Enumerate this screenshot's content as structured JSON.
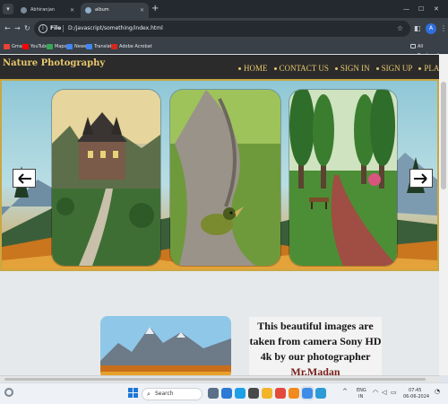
{
  "browser": {
    "tabs": [
      {
        "label": "Abhiranjan",
        "active": false
      },
      {
        "label": "album",
        "active": true
      }
    ],
    "new_tab_glyph": "+",
    "window_controls": [
      "—",
      "☐",
      "✕"
    ],
    "address": {
      "scheme_chip": "File",
      "url": "D:/javascript/something/index.html"
    },
    "avatar_letter": "A",
    "bookmarks": [
      {
        "label": "Gmail",
        "color": "#ea4335"
      },
      {
        "label": "YouTube",
        "color": "#ff0000"
      },
      {
        "label": "Maps",
        "color": "#34a853"
      },
      {
        "label": "News",
        "color": "#4285f4"
      },
      {
        "label": "Translate",
        "color": "#4285f4"
      },
      {
        "label": "Adobe Acrobat",
        "color": "#d7261e"
      }
    ],
    "all_bookmarks_label": "All Bookmarks"
  },
  "site": {
    "brand": "Nature Photography",
    "nav": [
      {
        "label": "HOME"
      },
      {
        "label": "CONTACT US"
      },
      {
        "label": "SIGN IN"
      },
      {
        "label": "SIGN UP"
      },
      {
        "label": "PLACE ORDER"
      }
    ],
    "carousel": {
      "prev_icon": "arrow-left-icon",
      "next_icon": "arrow-right-icon",
      "slides": [
        {
          "subject": "castle-mansion-photo"
        },
        {
          "subject": "bird-on-tree-photo"
        },
        {
          "subject": "park-path-bench-photo"
        }
      ]
    },
    "intro": {
      "text_before": "This beautiful images are taken from camera Sony HD 4k by our photographer",
      "photographer": "Mr.Madan"
    }
  },
  "taskbar": {
    "search_placeholder": "Search",
    "language": "ENG",
    "region": "IN",
    "time": "07:45",
    "date": "06-06-2024"
  },
  "colors": {
    "accent_gold": "#e7c76e",
    "header_bg": "#2b2b2b",
    "hero_border": "#caa742",
    "photographer_name": "#7a1d1d"
  }
}
